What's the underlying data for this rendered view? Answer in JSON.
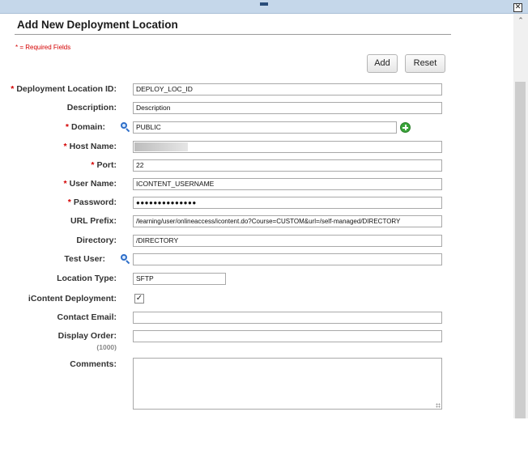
{
  "dialog": {
    "title": "Add New Deployment Location",
    "required_note": "* = Required Fields",
    "close_glyph": "✕"
  },
  "buttons": {
    "add": "Add",
    "reset": "Reset"
  },
  "fields": {
    "location_id": {
      "label": "Deployment Location ID:",
      "required": true,
      "value": "DEPLOY_LOC_ID"
    },
    "description": {
      "label": "Description:",
      "required": false,
      "value": "Description"
    },
    "domain": {
      "label": "Domain:",
      "required": true,
      "value": "PUBLIC"
    },
    "host_name": {
      "label": "Host Name:",
      "required": true,
      "value": ""
    },
    "port": {
      "label": "Port:",
      "required": true,
      "value": "22"
    },
    "user_name": {
      "label": "User Name:",
      "required": true,
      "value": "ICONTENT_USERNAME"
    },
    "password": {
      "label": "Password:",
      "required": true,
      "value": "●●●●●●●●●●●●●●"
    },
    "url_prefix": {
      "label": "URL Prefix:",
      "required": false,
      "value": "/learning/user/onlineaccess/icontent.do?Course=CUSTOM&url=/self-managed/DIRECTORY"
    },
    "directory": {
      "label": "Directory:",
      "required": false,
      "value": "/DIRECTORY"
    },
    "test_user": {
      "label": "Test User:",
      "required": false,
      "value": ""
    },
    "location_type": {
      "label": "Location Type:",
      "required": false,
      "value": "SFTP"
    },
    "icontent_deployment": {
      "label": "iContent Deployment:",
      "required": false,
      "checked": true,
      "check_glyph": "✓"
    },
    "contact_email": {
      "label": "Contact Email:",
      "required": false,
      "value": ""
    },
    "display_order": {
      "label": "Display Order:",
      "required": false,
      "value": "",
      "hint": "(1000)"
    },
    "comments": {
      "label": "Comments:",
      "required": false,
      "value": ""
    }
  },
  "required_marker": "*",
  "scrollbar": {
    "up_glyph": "⌃"
  },
  "icons": {
    "lookup": "search-icon",
    "add_domain": "plus-circle-icon"
  },
  "colors": {
    "required": "#d40000",
    "titlebar": "#c5d7ea",
    "add_icon": "#3aa53a",
    "lookup_icon": "#2f6fc9"
  }
}
